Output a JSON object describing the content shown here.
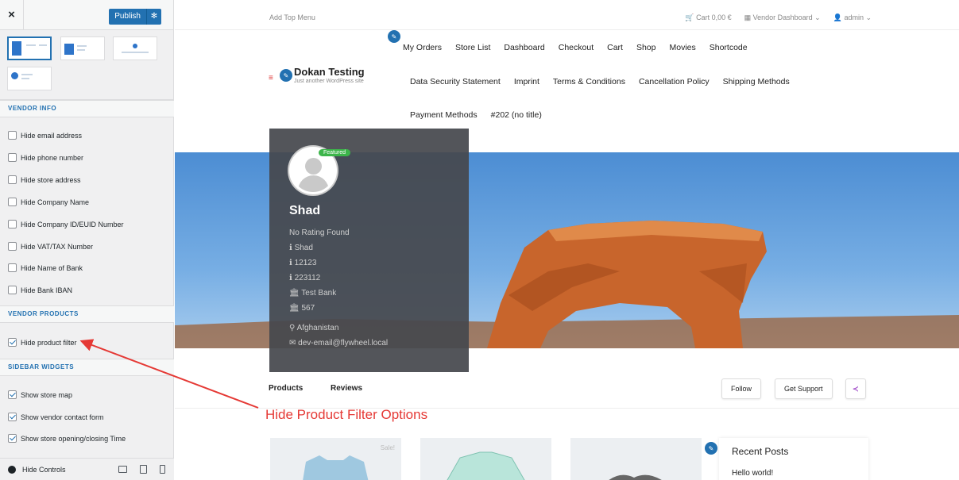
{
  "sidebar": {
    "close_icon": "×",
    "publish_label": "Publish",
    "sections": {
      "vendor_info": "VENDOR INFO",
      "vendor_products": "VENDOR PRODUCTS",
      "sidebar_widgets": "SIDEBAR WIDGETS"
    },
    "vendor_info_options": [
      {
        "label": "Hide email address",
        "checked": false
      },
      {
        "label": "Hide phone number",
        "checked": false
      },
      {
        "label": "Hide store address",
        "checked": false
      },
      {
        "label": "Hide Company Name",
        "checked": false
      },
      {
        "label": "Hide Company ID/EUID Number",
        "checked": false
      },
      {
        "label": "Hide VAT/TAX Number",
        "checked": false
      },
      {
        "label": "Hide Name of Bank",
        "checked": false
      },
      {
        "label": "Hide Bank IBAN",
        "checked": false
      }
    ],
    "vendor_products_options": [
      {
        "label": "Hide product filter",
        "checked": true
      }
    ],
    "sidebar_widget_options": [
      {
        "label": "Show store map",
        "checked": true
      },
      {
        "label": "Show vendor contact form",
        "checked": true
      },
      {
        "label": "Show store opening/closing Time",
        "checked": true
      }
    ],
    "footer": {
      "hide_controls": "Hide Controls"
    }
  },
  "topbar": {
    "add_menu": "Add Top Menu",
    "cart": "Cart 0,00 €",
    "vendor_dashboard": "Vendor Dashboard",
    "user": "admin"
  },
  "site": {
    "title": "Dokan Testing",
    "tagline": "Just another WordPress site"
  },
  "nav": {
    "row1": [
      "My Orders",
      "Store List",
      "Dashboard",
      "Checkout",
      "Cart",
      "Shop",
      "Movies",
      "Shortcode"
    ],
    "row2": [
      "Data Security Statement",
      "Imprint",
      "Terms & Conditions",
      "Cancellation Policy",
      "Shipping Methods"
    ],
    "row3": [
      "Payment Methods",
      "#202 (no title)"
    ]
  },
  "vendor": {
    "badge": "Featured",
    "name": "Shad",
    "rating": "No Rating Found",
    "company": "Shad",
    "company_id": "12123",
    "vat": "223112",
    "bank": "Test Bank",
    "iban": "567",
    "address": "Afghanistan",
    "email": "dev-email@flywheel.local"
  },
  "store_tabs": {
    "products": "Products",
    "reviews": "Reviews",
    "follow": "Follow",
    "support": "Get Support"
  },
  "annotation": "Hide Product Filter Options",
  "products": {
    "sale_badge": "Sale!"
  },
  "widgets": {
    "recent_posts": "Recent Posts",
    "first_post": "Hello world!"
  },
  "colors": {
    "accent": "#2271b1",
    "annotation": "#e53935",
    "featured": "#3cb54a"
  }
}
